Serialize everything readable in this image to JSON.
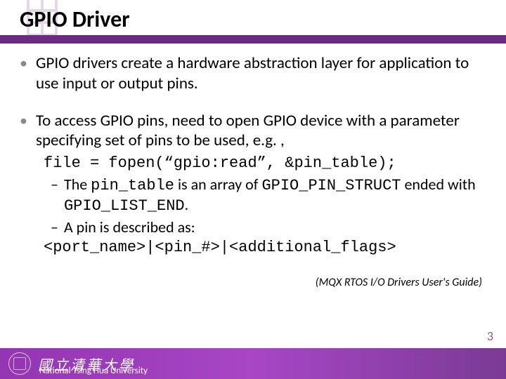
{
  "title": "GPIO Driver",
  "bullets": [
    {
      "text": "GPIO drivers create a hardware abstraction layer for application to use input or output pins."
    },
    {
      "text": "To access GPIO pins, need to open GPIO device with a parameter specifying set of pins to be used, e.g. ,",
      "code": "file = fopen(“gpio:read”, &pin_table);",
      "subs": [
        {
          "pre": "The ",
          "c1": "pin_table",
          "mid": " is an array of ",
          "c2": "GPIO_PIN_STRUCT",
          "mid2": " ended with ",
          "c3": "GPIO_LIST_END",
          "post": "."
        },
        {
          "pre": "A pin is described as:"
        }
      ],
      "code2": "<port_name>|<pin_#>|<additional_flags>"
    }
  ],
  "citation": "(MQX RTOS I/O Drivers User's Guide)",
  "footer": {
    "cn": "國立清華大學",
    "en": "National Tsing Hua University"
  },
  "page": "3"
}
